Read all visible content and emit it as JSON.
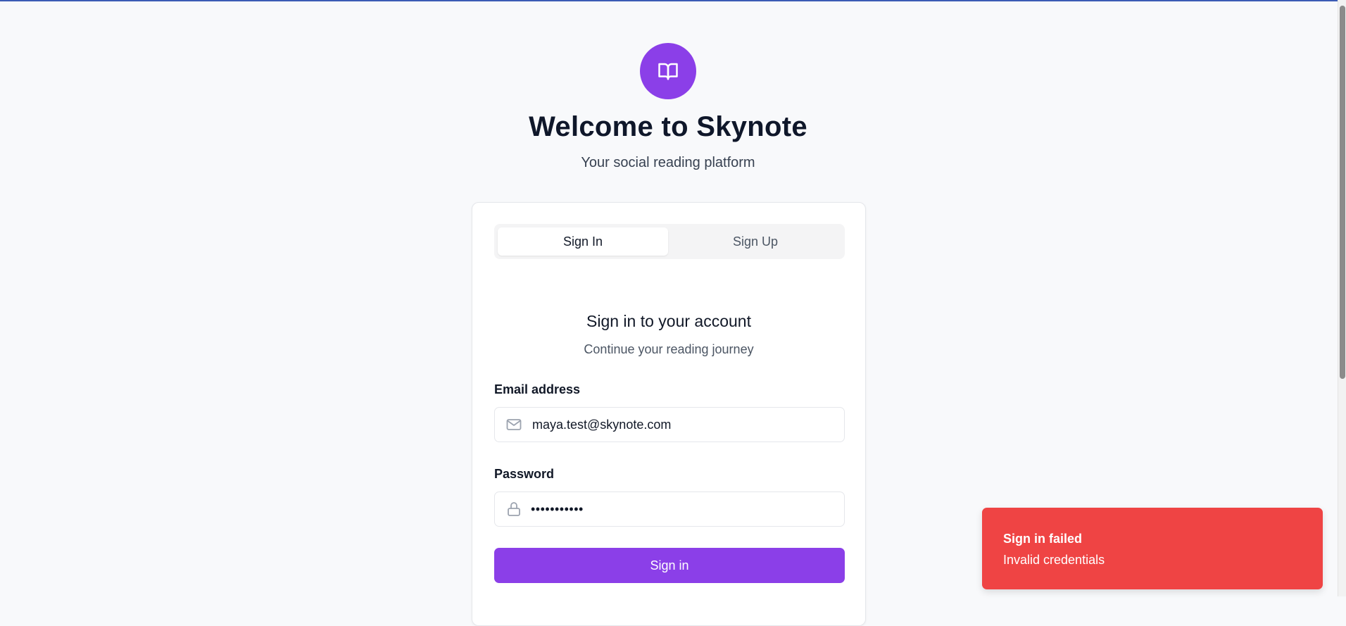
{
  "app": {
    "title": "Welcome to Skynote",
    "subtitle": "Your social reading platform",
    "logo_icon": "open-book-icon",
    "accent_color": "#8b3fe8"
  },
  "tabs": {
    "signin_label": "Sign In",
    "signup_label": "Sign Up",
    "active": "Sign In"
  },
  "form": {
    "title": "Sign in to your account",
    "subtitle": "Continue your reading journey",
    "email_label": "Email address",
    "email_value": "maya.test@skynote.com",
    "email_icon": "mail-icon",
    "password_label": "Password",
    "password_masked": "•••••••••••",
    "password_icon": "lock-icon",
    "submit_label": "Sign in"
  },
  "toast": {
    "title": "Sign in failed",
    "message": "Invalid credentials",
    "color": "#ef4444"
  }
}
